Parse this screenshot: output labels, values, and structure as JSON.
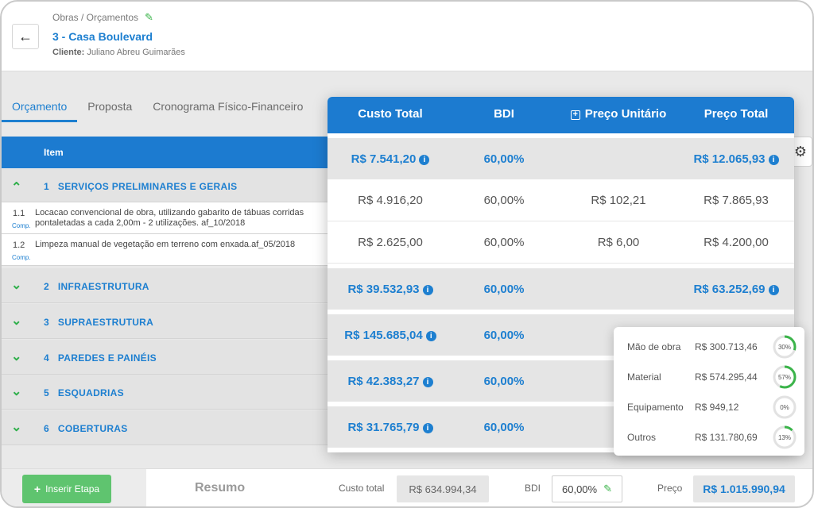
{
  "header": {
    "breadcrumb": "Obras / Orçamentos",
    "title": "3 - Casa Boulevard",
    "client_label": "Cliente:",
    "client_name": "Juliano Abreu Guimarães"
  },
  "tabs": [
    "Orçamento",
    "Proposta",
    "Cronograma Físico-Financeiro"
  ],
  "table": {
    "item_header": "Item",
    "rows": [
      {
        "type": "section",
        "num": "1",
        "label": "SERVIÇOS PRELIMINARES E GERAIS",
        "expanded": true
      },
      {
        "type": "item",
        "num": "1.1",
        "comp": "Comp.",
        "desc": "Locacao convencional de obra, utilizando gabarito de tábuas corridas pontaletadas a cada 2,00m - 2 utilizações. af_10/2018"
      },
      {
        "type": "item",
        "num": "1.2",
        "comp": "Comp.",
        "desc": "Limpeza manual de vegetação em terreno com enxada.af_05/2018"
      },
      {
        "type": "section",
        "num": "2",
        "label": "INFRAESTRUTURA",
        "expanded": false
      },
      {
        "type": "section",
        "num": "3",
        "label": "SUPRAESTRUTURA",
        "expanded": false
      },
      {
        "type": "section",
        "num": "4",
        "label": "PAREDES E PAINÉIS",
        "expanded": false
      },
      {
        "type": "section",
        "num": "5",
        "label": "ESQUADRIAS",
        "expanded": false
      },
      {
        "type": "section",
        "num": "6",
        "label": "COBERTURAS",
        "expanded": false
      }
    ]
  },
  "pricing": {
    "headers": {
      "custo_total": "Custo Total",
      "bdi": "BDI",
      "preco_unitario": "Preço Unitário",
      "preco_total": "Preço Total"
    },
    "rows": [
      {
        "kind": "section",
        "custo": "R$ 7.541,20",
        "bdi": "60,00%",
        "unit": "",
        "total": "R$ 12.065,93"
      },
      {
        "kind": "item",
        "custo": "R$ 4.916,20",
        "bdi": "60,00%",
        "unit": "R$ 102,21",
        "total": "R$ 7.865,93"
      },
      {
        "kind": "item",
        "custo": "R$ 2.625,00",
        "bdi": "60,00%",
        "unit": "R$ 6,00",
        "total": "R$ 4.200,00"
      },
      {
        "kind": "section",
        "custo": "R$ 39.532,93",
        "bdi": "60,00%",
        "unit": "",
        "total": "R$ 63.252,69"
      },
      {
        "kind": "section",
        "custo": "R$ 145.685,04",
        "bdi": "60,00%",
        "unit": "",
        "total": ""
      },
      {
        "kind": "section",
        "custo": "R$ 42.383,27",
        "bdi": "60,00%",
        "unit": "",
        "total": ""
      },
      {
        "kind": "section",
        "custo": "R$ 31.765,79",
        "bdi": "60,00%",
        "unit": "",
        "total": ""
      }
    ]
  },
  "breakdown": [
    {
      "label": "Mão de obra",
      "value": "R$ 300.713,46",
      "pct": "30%",
      "fraction": 0.3
    },
    {
      "label": "Material",
      "value": "R$ 574.295,44",
      "pct": "57%",
      "fraction": 0.57
    },
    {
      "label": "Equipamento",
      "value": "R$ 949,12",
      "pct": "0%",
      "fraction": 0.0
    },
    {
      "label": "Outros",
      "value": "R$ 131.780,69",
      "pct": "13%",
      "fraction": 0.13
    }
  ],
  "footer": {
    "insert_label": "Inserir Etapa",
    "resumo": "Resumo",
    "custo_label": "Custo total",
    "custo_value": "R$ 634.994,34",
    "bdi_label": "BDI",
    "bdi_value": "60,00%",
    "preco_label": "Preço",
    "preco_value": "R$ 1.015.990,94"
  },
  "colors": {
    "primary": "#1c7bd0",
    "accent_green": "#3bb44a",
    "ring_track": "#e2e2e2"
  }
}
